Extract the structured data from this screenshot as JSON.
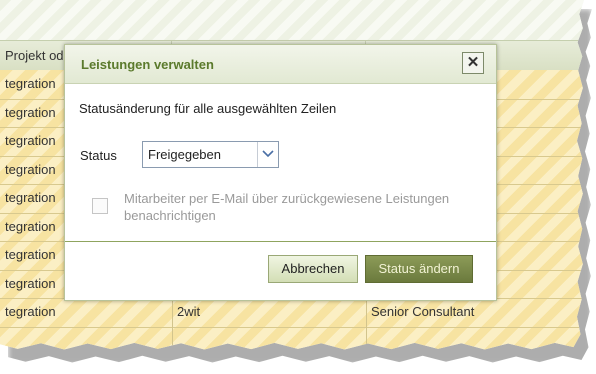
{
  "grid": {
    "header": [
      "Projekt od",
      "",
      ""
    ],
    "rows": [
      [
        "tegration",
        "",
        ""
      ],
      [
        "tegration",
        "",
        ""
      ],
      [
        "tegration",
        "",
        ""
      ],
      [
        "tegration",
        "",
        ""
      ],
      [
        "tegration",
        "",
        ""
      ],
      [
        "tegration",
        "",
        ""
      ],
      [
        "tegration",
        "",
        ""
      ],
      [
        "tegration",
        "",
        ""
      ],
      [
        "tegration",
        "2wit",
        "Senior Consultant"
      ],
      [
        "",
        "",
        ""
      ]
    ]
  },
  "modal": {
    "title": "Leistungen verwalten",
    "description": "Statusänderung für alle ausgewählten Zeilen",
    "status_label": "Status",
    "status_value": "Freigegeben",
    "notify_label": "Mitarbeiter per E-Mail über zurückgewiesene Leistungen benachrichtigen",
    "notify_checked": false,
    "cancel_label": "Abbrechen",
    "submit_label": "Status ändern",
    "close_icon": "close-icon"
  },
  "colors": {
    "accent_green": "#5b7a2c",
    "button_dark": "#6b7a3d",
    "row_yellow": "#f7e3a1"
  }
}
